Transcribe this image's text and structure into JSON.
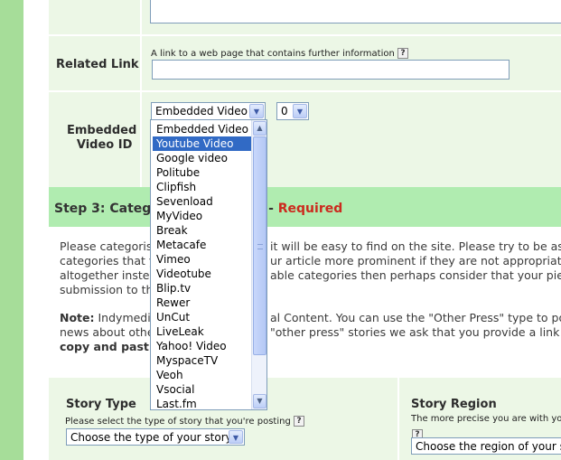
{
  "related_link": {
    "label": "Related Link",
    "hint": "A link to a web page that contains further information",
    "help_glyph": "?",
    "value": ""
  },
  "embedded_video": {
    "label_line1": "Embedded",
    "label_line2": "Video ID",
    "type_select_value": "Embedded Video",
    "count_select_value": "0",
    "options": [
      "Embedded Video",
      "Youtube Video",
      "Google video",
      "Politube",
      "Clipfish",
      "Sevenload",
      "MyVideo",
      "Break",
      "Metacafe",
      "Vimeo",
      "Videotube",
      "Blip.tv",
      "Rewer",
      "UnCut",
      "LiveLeak",
      "Yahoo! Video",
      "MyspaceTV",
      "Veoh",
      "Vsocial",
      "Last.fm"
    ],
    "highlighted_option": "Youtube Video"
  },
  "step3": {
    "title": "Step 3: Categ",
    "dash": "-",
    "required": "Required",
    "colors": {
      "bar": "#b0ecb0",
      "required": "#cc2a1e"
    }
  },
  "body_text": {
    "line1a": "Please categoris",
    "line1b": "it will be easy to find on the site. Please try to be as ac",
    "line2a": "categories that y",
    "line2b": "ur article more prominent if they are not appropriate - y",
    "line3a": "altogether instea",
    "line3b": "able categories then perhaps consider that your piece",
    "line4a": "submission to the",
    "note_label": "Note:",
    "note_a": "Indymedia",
    "note_b": "al Content. You can use the \"Other Press\" type to post",
    "note2_a": "news about other",
    "note2_b": "\"other press\" stories we ask that you provide a link an",
    "note3": "copy and past"
  },
  "story_type": {
    "label": "Story Type",
    "hint": "Please select the type of story that you're posting",
    "select_value": "Choose the type of your story"
  },
  "story_region": {
    "label": "Story Region",
    "hint": "The more precise you are with you",
    "select_value": "Choose the region of your st"
  }
}
